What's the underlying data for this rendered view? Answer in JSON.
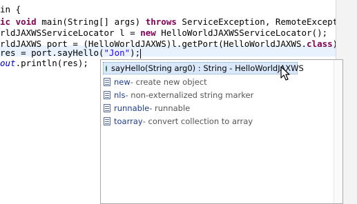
{
  "editor": {
    "lines": [
      {
        "parts": [
          {
            "t": "in {",
            "c": ""
          }
        ]
      },
      {
        "parts": [
          {
            "t": "ic void",
            "c": "kw"
          },
          {
            "t": " main(String[] args) ",
            "c": ""
          },
          {
            "t": "throws",
            "c": "kw"
          },
          {
            "t": " ServiceException, RemoteException",
            "c": ""
          }
        ]
      },
      {
        "parts": [
          {
            "t": "rldJAXWSServiceLocator l = ",
            "c": ""
          },
          {
            "t": "new",
            "c": "kw"
          },
          {
            "t": " HelloWorldJAXWSServiceLocator();",
            "c": ""
          }
        ]
      },
      {
        "parts": [
          {
            "t": "rldJAXWS port = (HelloWorldJAXWS)l.getPort(HelloWorldJAXWS.",
            "c": ""
          },
          {
            "t": "class",
            "c": "kw"
          },
          {
            "t": ");",
            "c": ""
          }
        ]
      },
      {
        "parts": [
          {
            "t": "res = port.sayHello(",
            "c": ""
          },
          {
            "t": "\"Jon\"",
            "c": "str"
          },
          {
            "t": ");",
            "c": ""
          }
        ]
      },
      {
        "parts": [
          {
            "t": "out",
            "c": "fld"
          },
          {
            "t": ".println(res);",
            "c": ""
          }
        ]
      }
    ]
  },
  "proposals": {
    "items": [
      {
        "kind": "method",
        "name": "sayHello(String arg0) : String - HelloWorldJAXWS",
        "desc": "",
        "selected": true
      },
      {
        "kind": "template",
        "name": "new",
        "desc": " - create new object",
        "selected": false
      },
      {
        "kind": "template",
        "name": "nls",
        "desc": " - non-externalized string marker",
        "selected": false
      },
      {
        "kind": "template",
        "name": "runnable",
        "desc": " - runnable",
        "selected": false
      },
      {
        "kind": "template",
        "name": "toarray",
        "desc": " - convert collection to array",
        "selected": false
      }
    ]
  },
  "icons": {
    "method": "public-method-icon",
    "template": "template-icon",
    "cursor": "mouse-pointer-icon"
  },
  "colors": {
    "keyword": "#7f0055",
    "string": "#2a00ff",
    "field": "#0000c0",
    "selection": "#d9e9fb"
  }
}
